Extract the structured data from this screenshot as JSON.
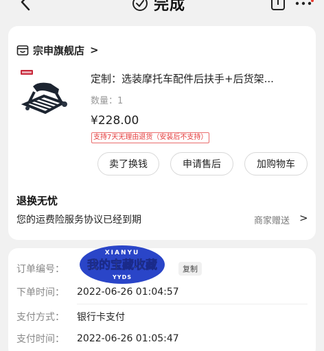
{
  "nav": {
    "title": "完成",
    "back_icon": "chevron-left-icon",
    "share_icon": "share-icon",
    "more_icon": "more-dots-icon",
    "notification_dot_color": "#e8392e"
  },
  "shop": {
    "name": "宗申旗舰店",
    "chevron": ">"
  },
  "product": {
    "title": "定制：选装摩托车配件后扶手+后货架...",
    "quantity": "数量：1",
    "price": "¥228.00",
    "return_policy": "支持7天无理由退货（安装后不支持）"
  },
  "actions": {
    "sell": "卖了换钱",
    "aftersale": "申请售后",
    "cart": "加购物车"
  },
  "guarantee": {
    "title": "退换无忧",
    "description": "您的运费险服务协议已经到期",
    "gift": "商家赠送",
    "chevron": ">"
  },
  "order": {
    "number_label": "订单编号：",
    "copy_label": "复制",
    "sticker": {
      "top": "XIANYU",
      "main": "我的宝藏收藏",
      "bottom": "YYDS"
    },
    "created_label": "下单时间：",
    "created_value": "2022-06-26 01:04:57",
    "payment_method_label": "支付方式：",
    "payment_method_value": "银行卡支付",
    "payment_time_label": "支付时间：",
    "payment_time_value": "2022-06-26 01:05:47"
  },
  "colors": {
    "background": "#f1f1f1",
    "card": "#ffffff",
    "accent_red": "#e43a3a",
    "sticker_blue": "#2a45c8",
    "sticker_yellow": "#e8f23a"
  }
}
